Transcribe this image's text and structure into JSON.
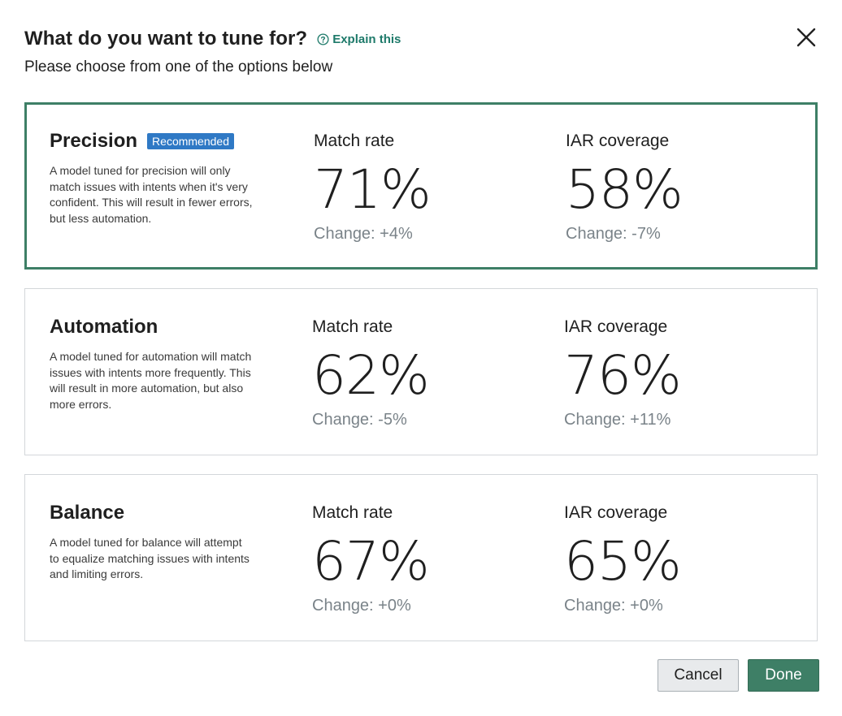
{
  "header": {
    "title": "What do you want to tune for?",
    "explain_label": "Explain this",
    "subtitle": "Please choose from one of the options below"
  },
  "options": [
    {
      "name": "Precision",
      "badge": "Recommended",
      "description": "A model tuned for precision will only match issues with intents when it's very confident. This will result in fewer errors, but less automation.",
      "metrics": [
        {
          "label": "Match rate",
          "value": "71%",
          "change": "Change: +4%"
        },
        {
          "label": "IAR coverage",
          "value": "58%",
          "change": "Change: -7%"
        }
      ]
    },
    {
      "name": "Automation",
      "description": "A model tuned for automation will match issues with intents more frequently. This will result in more automation, but also more errors.",
      "metrics": [
        {
          "label": "Match rate",
          "value": "62%",
          "change": "Change: -5%"
        },
        {
          "label": "IAR coverage",
          "value": "76%",
          "change": "Change: +11%"
        }
      ]
    },
    {
      "name": "Balance",
      "description": "A model tuned for balance will attempt to equalize matching issues with intents and limiting errors.",
      "metrics": [
        {
          "label": "Match rate",
          "value": "67%",
          "change": "Change: +0%"
        },
        {
          "label": "IAR coverage",
          "value": "65%",
          "change": "Change: +0%"
        }
      ]
    }
  ],
  "footer": {
    "cancel_label": "Cancel",
    "done_label": "Done"
  },
  "colors": {
    "accent": "#3e7f66",
    "badge": "#2f79c5",
    "link": "#1e7a6a"
  },
  "icons": {
    "explain": "help-circle-icon",
    "close": "close-icon"
  }
}
